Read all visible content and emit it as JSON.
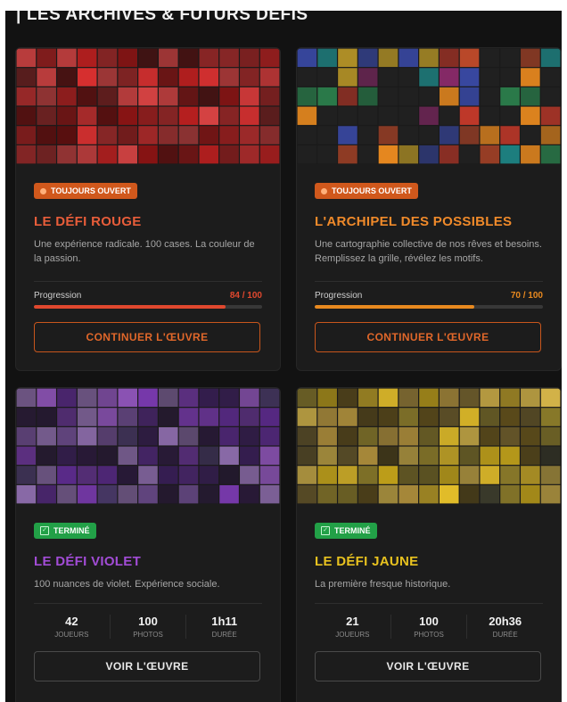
{
  "section": {
    "title": "LES ARCHIVES & FUTURS DÉFIS"
  },
  "cards": [
    {
      "badge": "TOUJOURS OUVERT",
      "title": "LE DÉFI ROUGE",
      "title_color": "#e85d3a",
      "description": "Une expérience radicale. 100 cases. La couleur de la passion.",
      "progress_label": "Progression",
      "progress_text": "84 / 100",
      "progress_value": 84,
      "progress_max": 100,
      "accent": "#e0482e",
      "button": "CONTINUER L'ŒUVRE",
      "thumb_palette": [
        "#b51f1f",
        "#d93030",
        "#8a1414",
        "#e04545",
        "#a82828",
        "#5c0f0f",
        "#c93838",
        "#7a2020"
      ]
    },
    {
      "badge": "TOUJOURS OUVERT",
      "title": "L'ARCHIPEL DES POSSIBLES",
      "title_color": "#f08a2a",
      "description": "Une cartographie collective de nos rêves et besoins. Remplissez la grille, révélez les motifs.",
      "progress_label": "Progression",
      "progress_text": "70 / 100",
      "progress_value": 70,
      "progress_max": 100,
      "accent": "#e8891f",
      "button": "CONTINUER L'ŒUVRE",
      "thumb_palette": [
        "#e8891f",
        "#c73a2a",
        "#2a7a4a",
        "#3a4aa8",
        "#d9b02a",
        "#8a2a6a",
        "#1e8a8a",
        "#c04a2a"
      ]
    },
    {
      "badge": "TERMINÉ",
      "title": "LE DÉFI VIOLET",
      "title_color": "#a24cd6",
      "description": "100 nuances de violet. Expérience sociale.",
      "stats": [
        {
          "value": "42",
          "label": "JOUEURS"
        },
        {
          "value": "100",
          "label": "PHOTOS"
        },
        {
          "value": "1h11",
          "label": "DURÉE"
        }
      ],
      "button": "VOIR L'ŒUVRE",
      "thumb_palette": [
        "#5a2a8a",
        "#7a3ab0",
        "#3a1e5a",
        "#9a5ac8",
        "#4a3a6a",
        "#6a4a8a",
        "#2a1a3a",
        "#8a6aa8"
      ]
    },
    {
      "badge": "TERMINÉ",
      "title": "LE DÉFI JAUNE",
      "title_color": "#e8c21f",
      "description": "La première fresque historique.",
      "stats": [
        {
          "value": "21",
          "label": "JOUEURS"
        },
        {
          "value": "100",
          "label": "PHOTOS"
        },
        {
          "value": "20h36",
          "label": "DURÉE"
        }
      ],
      "button": "VOIR L'ŒUVRE",
      "thumb_palette": [
        "#c9a81a",
        "#8a7a2a",
        "#e8c22a",
        "#5a4a1a",
        "#a88a3a",
        "#3a3a2a",
        "#d9b84a",
        "#6a5a2a"
      ]
    }
  ]
}
